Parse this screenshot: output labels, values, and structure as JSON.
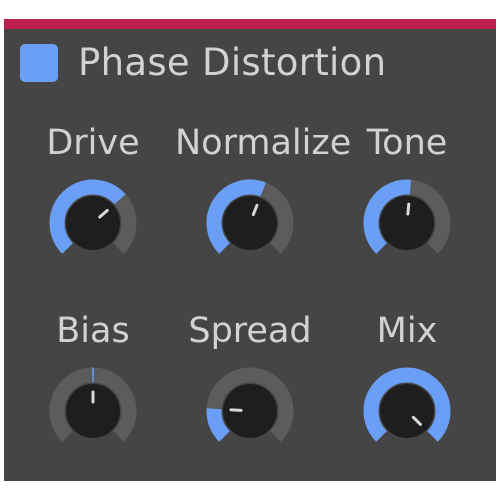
{
  "header": {
    "title": "Phase Distortion",
    "accent_color": "#bd1f4e",
    "enable_color": "#6b9ef5"
  },
  "knobs": [
    {
      "label": "Drive",
      "value": 0.68,
      "bipolar": false
    },
    {
      "label": "Normalize",
      "value": 0.58,
      "bipolar": false
    },
    {
      "label": "Tone",
      "value": 0.52,
      "bipolar": false
    },
    {
      "label": "Bias",
      "value": 0.5,
      "bipolar": true
    },
    {
      "label": "Spread",
      "value": 0.18,
      "bipolar": false
    },
    {
      "label": "Mix",
      "value": 1.0,
      "bipolar": false
    }
  ],
  "colors": {
    "panel": "#454545",
    "track": "#5c5c5c",
    "arc": "#6b9ef5",
    "knob_body": "#1e1e1e",
    "indicator": "#d8d8d8",
    "label": "#d2d2d2"
  }
}
